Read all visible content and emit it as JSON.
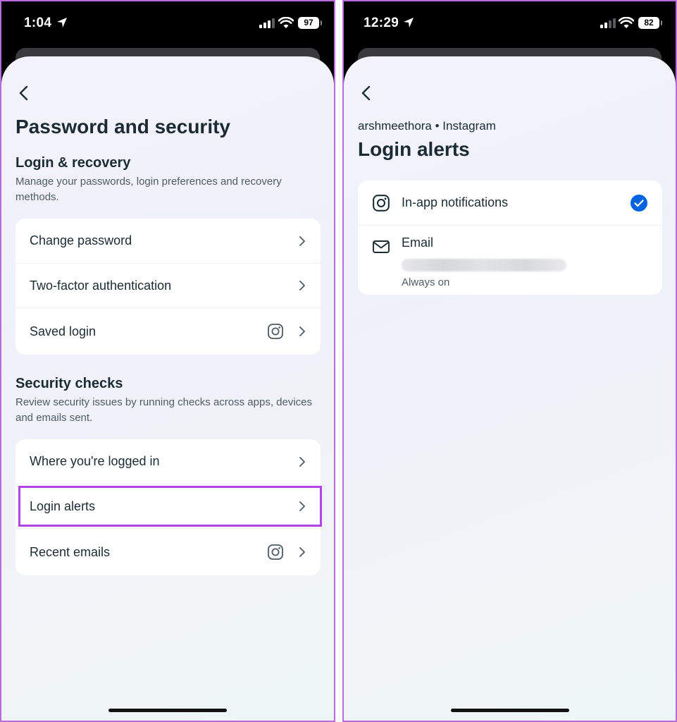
{
  "left_screen": {
    "status": {
      "time": "1:04",
      "battery": "97"
    },
    "title": "Password and security",
    "login_recovery": {
      "title": "Login & recovery",
      "description": "Manage your passwords, login preferences and recovery methods.",
      "items": [
        {
          "label": "Change password"
        },
        {
          "label": "Two-factor authentication"
        },
        {
          "label": "Saved login"
        }
      ]
    },
    "security_checks": {
      "title": "Security checks",
      "description": "Review security issues by running checks across apps, devices and emails sent.",
      "items": [
        {
          "label": "Where you're logged in"
        },
        {
          "label": "Login alerts"
        },
        {
          "label": "Recent emails"
        }
      ]
    }
  },
  "right_screen": {
    "status": {
      "time": "12:29",
      "battery": "82"
    },
    "account_line": "arshmeethora • Instagram",
    "title": "Login alerts",
    "options": [
      {
        "label": "In-app notifications",
        "checked": true
      },
      {
        "label": "Email",
        "sublabel": "Always on"
      }
    ]
  },
  "colors": {
    "accent": "#0064e0",
    "highlight": "#b046e6",
    "text": "#1c2b33"
  },
  "icons": [
    "location-arrow-icon",
    "signal-icon",
    "wifi-icon",
    "battery-icon",
    "back-icon",
    "chevron-right-icon",
    "instagram-icon",
    "mail-icon",
    "check-circle-icon"
  ]
}
